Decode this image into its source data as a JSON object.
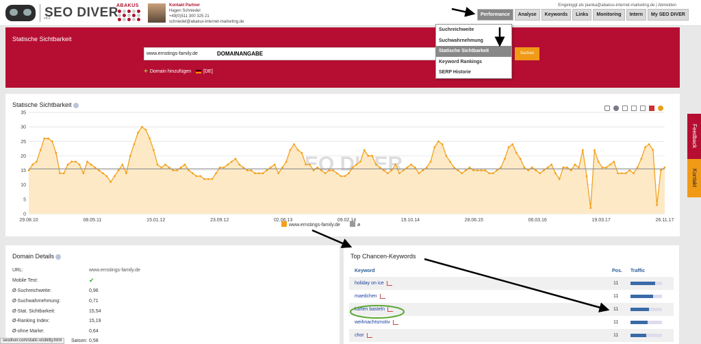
{
  "header": {
    "logo_text": "SEO DIVER",
    "logo_version": "v4.0",
    "abakus": "ABAKUS",
    "partner_title": "Kontakt Partner",
    "partner_name": "Hagen Schniedel",
    "partner_phone": "+49(0)511 300 325 21",
    "partner_email": "schniedel@abakus-internet-marketing.de",
    "login_text": "Eingeloggt als pianka@abakus-internet-marketing.de | Abmelden"
  },
  "nav": [
    {
      "label": "Performance",
      "active": true
    },
    {
      "label": "Analyse"
    },
    {
      "label": "Keywords"
    },
    {
      "label": "Links"
    },
    {
      "label": "Monitoring"
    },
    {
      "label": "Intern"
    },
    {
      "label": "My SEO DIVER"
    }
  ],
  "dropdown": [
    {
      "label": "Suchreichweite"
    },
    {
      "label": "Suchwahrnehmung"
    },
    {
      "label": "Statische Sichtbarkeit",
      "selected": true
    },
    {
      "label": "Keyword Rankings"
    },
    {
      "label": "SERP Historie"
    }
  ],
  "top": {
    "title": "Statische Sichtbarkeit",
    "domain_value": "www.ernstings-family.de",
    "domain_tag": "DOMAINANGABE",
    "search_label": "Suchen",
    "add_domain": "Domain hinzufügen",
    "country": "[DE]"
  },
  "chart_panel": {
    "title": "Statische Sichtbarkeit"
  },
  "chart_data": {
    "type": "line",
    "x_ticks": [
      "29.08.10",
      "08.05.11",
      "15.01.12",
      "23.09.12",
      "02.06.13",
      "09.02.14",
      "19.10.14",
      "28.06.15",
      "06.03.16",
      "19.03.17",
      "26.11.17"
    ],
    "y_ticks": [
      0,
      5,
      10,
      15,
      20,
      25,
      30,
      35
    ],
    "ylim": [
      0,
      35
    ],
    "series": [
      {
        "name": "www.ernstings-family.de",
        "color": "#f3a11d",
        "values": [
          15,
          17,
          18,
          22,
          26,
          26,
          25,
          21,
          14,
          14,
          17,
          18,
          18,
          17,
          14,
          18,
          17,
          16,
          15,
          14,
          13,
          11,
          13,
          15,
          17,
          14,
          20,
          24,
          28,
          30,
          29,
          26,
          22,
          17,
          16,
          17,
          16,
          15,
          15,
          16,
          17,
          15,
          14,
          13,
          13,
          12,
          12,
          12,
          14,
          16,
          16,
          17,
          18,
          19,
          17,
          16,
          15,
          15,
          14,
          14,
          14,
          15,
          16,
          17,
          14,
          16,
          18,
          22,
          24,
          22,
          21,
          17,
          17,
          15,
          16,
          15,
          14,
          15,
          15,
          14,
          13,
          13,
          14,
          16,
          17,
          18,
          22,
          20,
          20,
          17,
          16,
          15,
          14,
          15,
          17,
          14,
          15,
          16,
          17,
          16,
          14,
          15,
          16,
          18,
          23,
          25,
          24,
          20,
          18,
          16,
          15,
          14,
          15,
          16,
          15,
          15,
          15,
          15,
          14,
          14,
          15,
          16,
          19,
          23,
          24,
          21,
          19,
          16,
          15,
          16,
          15,
          14,
          15,
          16,
          17,
          14,
          12,
          16,
          16,
          15,
          17,
          16,
          22,
          13,
          2,
          22,
          18,
          16,
          16,
          17,
          18,
          14,
          14,
          14,
          15,
          14,
          16,
          19,
          23,
          24,
          22,
          3,
          15,
          16
        ]
      },
      {
        "name": "ø",
        "color": "#999",
        "values": []
      }
    ],
    "average": 15.5
  },
  "domain_details": {
    "title": "Domain Details",
    "rows": [
      {
        "label": "URL:",
        "value": "www.ernstings-family.de"
      },
      {
        "label": "Mobile Test:",
        "value": "✔"
      },
      {
        "label": "Ø-Suchreichweite:",
        "value": "0,96"
      },
      {
        "label": "Ø-Suchwahrnehmung:",
        "value": "0,71"
      },
      {
        "label": "Ø-Stat. Sichtbarkeit:",
        "value": "15,54"
      },
      {
        "label": "Ø-Ranking Index:",
        "value": "15,19"
      },
      {
        "label": "Ø-ohne Marke:",
        "value": "0,64"
      },
      {
        "label": "Saison:",
        "value": "0,58"
      }
    ]
  },
  "keywords": {
    "title": "Top Chancen-Keywords",
    "col_keyword": "Keyword",
    "col_pos": "Pos.",
    "col_traffic": "Traffic",
    "rows": [
      {
        "keyword": "holiday on ice",
        "pos": "11",
        "traffic": 0.78
      },
      {
        "keyword": "maedchen",
        "pos": "11",
        "traffic": 0.72
      },
      {
        "keyword": "karten basteln",
        "pos": "11",
        "traffic": 0.58
      },
      {
        "keyword": "weihnachtsmotiv",
        "pos": "11",
        "traffic": 0.55
      },
      {
        "keyword": "chor",
        "pos": "11",
        "traffic": 0.5
      }
    ]
  },
  "sidetabs": {
    "feedback": "Feedback",
    "kontakt": "Kontakt"
  },
  "status": "seodiver.com/static-visibility.html"
}
